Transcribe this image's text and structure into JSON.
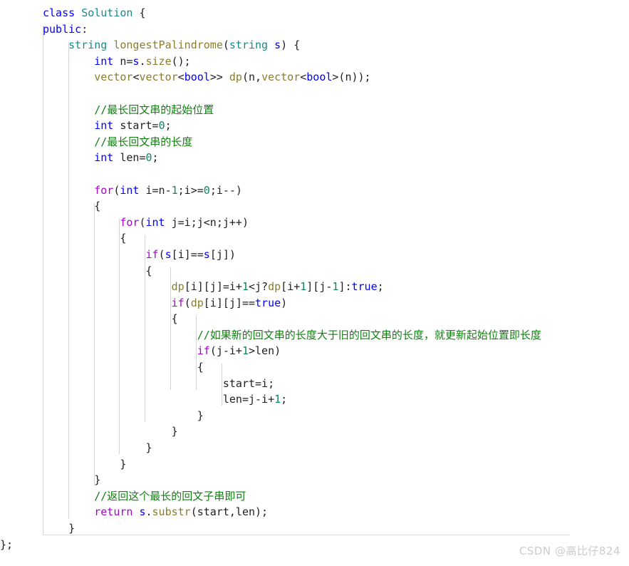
{
  "editor": {
    "language": "cpp",
    "background_color": "#ffffff",
    "indent_guide_color": "#d4d4d4",
    "separator_color": "#dcdcdc"
  },
  "syntax_colors": {
    "keyword_blue": "#0000ff",
    "keyword_magenta": "#aa00d4",
    "type_teal": "#1a8a8a",
    "function_olive": "#8a7d2b",
    "number_green": "#11855f",
    "comment_green": "#108010",
    "plain": "#1f1f1f"
  },
  "code": {
    "lines": [
      "class Solution {",
      "public:",
      "    string longestPalindrome(string s) {",
      "        int n=s.size();",
      "        vector<vector<bool>> dp(n,vector<bool>(n));",
      "",
      "        //最长回文串的起始位置",
      "        int start=0;",
      "        //最长回文串的长度",
      "        int len=0;",
      "",
      "        for(int i=n-1;i>=0;i--)",
      "        {",
      "            for(int j=i;j<n;j++)",
      "            {",
      "                if(s[i]==s[j])",
      "                {",
      "                    dp[i][j]=i+1<j?dp[i+1][j-1]:true;",
      "                    if(dp[i][j]==true)",
      "                    {",
      "                        //如果新的回文串的长度大于旧的回文串的长度，就更新起始位置即长度",
      "                        if(j-i+1>len)",
      "                        {",
      "                            start=i;",
      "                            len=j-i+1;",
      "                        }",
      "                    }",
      "                }",
      "            }",
      "        }",
      "        //返回这个最长的回文子串即可",
      "        return s.substr(start,len);",
      "    }",
      "};"
    ],
    "comments": [
      "//最长回文串的起始位置",
      "//最长回文串的长度",
      "//如果新的回文串的长度大于旧的回文串的长度，就更新起始位置即长度",
      "//返回这个最长的回文子串即可"
    ],
    "class_name": "Solution",
    "method_name": "longestPalindrome"
  },
  "watermark": {
    "text": "CSDN @高比仔824"
  }
}
